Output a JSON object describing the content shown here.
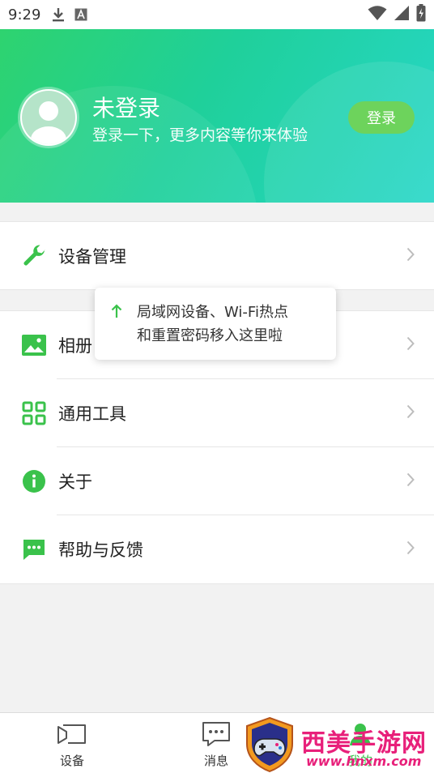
{
  "status_bar": {
    "time": "9:29"
  },
  "header": {
    "title": "未登录",
    "subtitle": "登录一下，更多内容等你来体验",
    "login_label": "登录"
  },
  "menu": {
    "device_management": "设备管理",
    "album": "相册",
    "tools": "通用工具",
    "about": "关于",
    "help": "帮助与反馈"
  },
  "tooltip": {
    "line1": "局域网设备、Wi-Fi热点",
    "line2": "和重置密码移入这里啦"
  },
  "tabbar": {
    "devices": "设备",
    "messages": "消息",
    "mine": "我的"
  },
  "watermark": {
    "title": "西美手游网",
    "url": "www.hnxm.com"
  },
  "colors": {
    "accent": "#3ac24b",
    "header_start": "#2ed36f",
    "header_end": "#27d7c8",
    "watermark": "#e8207a"
  }
}
